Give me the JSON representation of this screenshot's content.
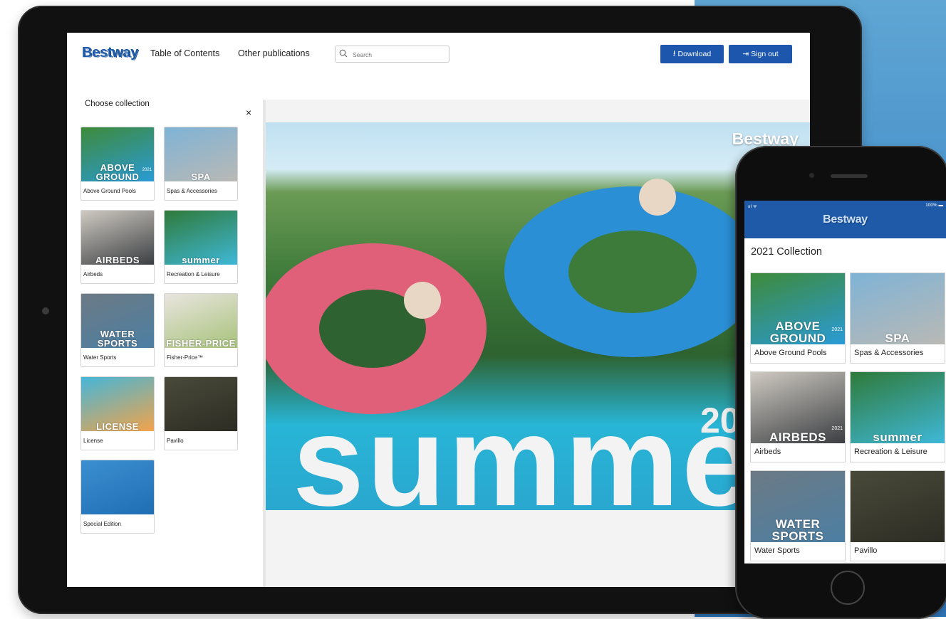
{
  "desktop": {
    "logo": "Bestway",
    "nav": [
      "Table of Contents",
      "Other publications"
    ],
    "search_placeholder": "Search",
    "download_label": "Download",
    "signout_label": "Sign out",
    "panel_title": "Choose collection",
    "close_symbol": "×",
    "collections": [
      {
        "label": "Above Ground Pools",
        "thumb_text": "ABOVE GROUND",
        "year": "2021",
        "colors": [
          "#3e8a3a",
          "#2a9bd6"
        ]
      },
      {
        "label": "Spas & Accessories",
        "thumb_text": "SPA",
        "year": "",
        "colors": [
          "#7fb3d6",
          "#b9b9b5"
        ]
      },
      {
        "label": "Airbeds",
        "thumb_text": "AIRBEDS",
        "year": "",
        "colors": [
          "#cfcac2",
          "#3b3e42"
        ]
      },
      {
        "label": "Recreation & Leisure",
        "thumb_text": "summer",
        "year": "",
        "colors": [
          "#2f7a3a",
          "#3fb8d8"
        ]
      },
      {
        "label": "Water Sports",
        "thumb_text": "WATER SPORTS",
        "year": "",
        "colors": [
          "#6c7a85",
          "#4c7fa3"
        ]
      },
      {
        "label": "Fisher-Price™",
        "thumb_text": "FISHER-PRICE",
        "year": "",
        "colors": [
          "#e9e5df",
          "#a7c27a"
        ]
      },
      {
        "label": "License",
        "thumb_text": "LICENSE",
        "year": "",
        "colors": [
          "#45b6d8",
          "#f2a34a"
        ]
      },
      {
        "label": "Pavillo",
        "thumb_text": "",
        "year": "",
        "colors": [
          "#4a4a3a",
          "#2c2c24"
        ]
      },
      {
        "label": "Special Edition",
        "thumb_text": "",
        "year": "",
        "colors": [
          "#3b8fd0",
          "#1f6eb4"
        ]
      }
    ],
    "cover": {
      "brand": "Bestway",
      "word": "summe",
      "year": "20"
    }
  },
  "mobile": {
    "status_left": "ııl ᯤ",
    "status_right": "100% ▬",
    "logo": "Bestway",
    "title": "2021 Collection",
    "collections": [
      {
        "label": "Above Ground Pools",
        "thumb_text": "ABOVE GROUND",
        "year": "2021",
        "colors": [
          "#3e8a3a",
          "#2a9bd6"
        ]
      },
      {
        "label": "Spas & Accessories",
        "thumb_text": "SPA",
        "year": "",
        "colors": [
          "#7fb3d6",
          "#b9b9b5"
        ]
      },
      {
        "label": "Airbeds",
        "thumb_text": "AIRBEDS",
        "year": "2021",
        "colors": [
          "#cfcac2",
          "#3b3e42"
        ]
      },
      {
        "label": "Recreation & Leisure",
        "thumb_text": "summer",
        "year": "",
        "colors": [
          "#2f7a3a",
          "#3fb8d8"
        ]
      },
      {
        "label": "Water Sports",
        "thumb_text": "WATER SPORTS",
        "year": "",
        "colors": [
          "#6c7a85",
          "#4c7fa3"
        ]
      },
      {
        "label": "Pavillo",
        "thumb_text": "",
        "year": "",
        "colors": [
          "#4a4a3a",
          "#2c2c24"
        ]
      }
    ]
  },
  "colors": {
    "brand_blue": "#1f5aa8",
    "button_blue": "#1c56ad"
  }
}
